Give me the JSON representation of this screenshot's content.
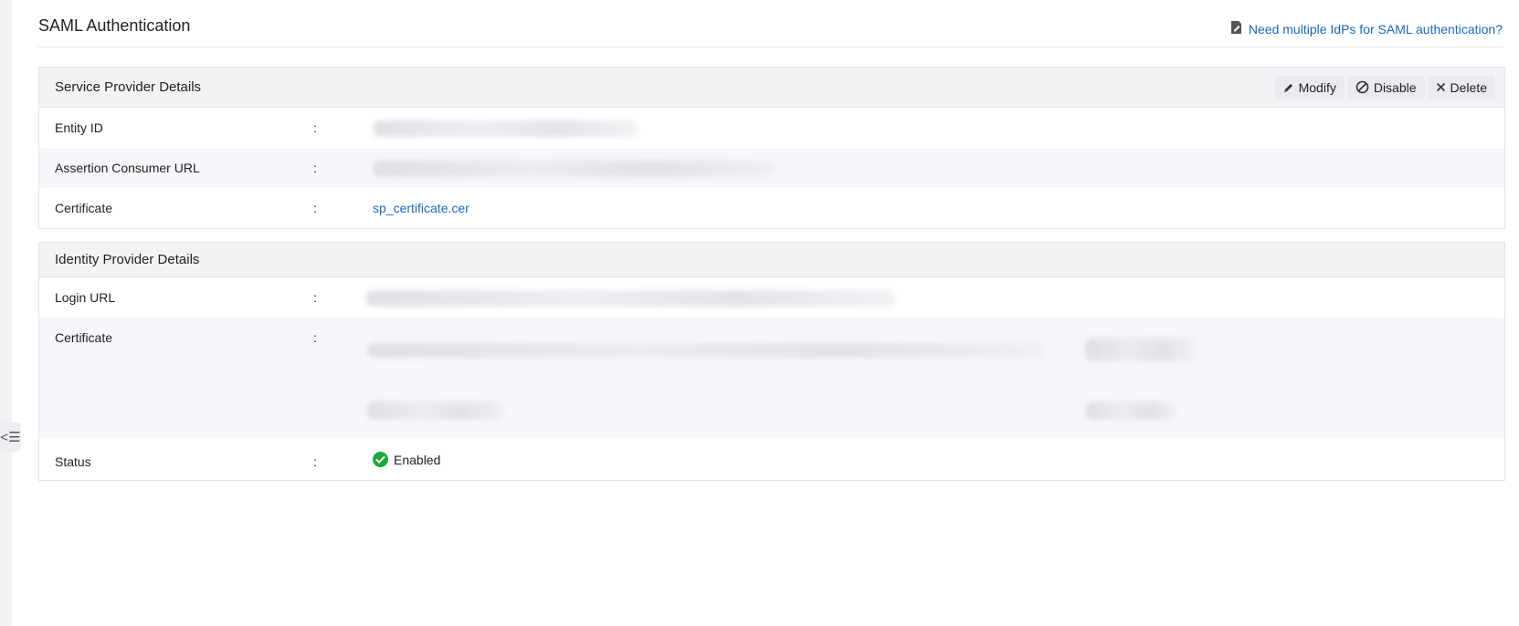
{
  "page": {
    "title": "SAML Authentication",
    "help_link": "Need multiple IdPs for SAML authentication?"
  },
  "service_provider": {
    "heading": "Service Provider Details",
    "actions": {
      "modify": "Modify",
      "disable": "Disable",
      "delete": "Delete"
    },
    "rows": [
      {
        "label": "Entity ID",
        "colon": ":"
      },
      {
        "label": "Assertion Consumer URL",
        "colon": ":"
      },
      {
        "label": "Certificate",
        "colon": ":",
        "value": "sp_certificate.cer"
      }
    ]
  },
  "identity_provider": {
    "heading": "Identity Provider Details",
    "rows": [
      {
        "label": "Login URL",
        "colon": ":"
      },
      {
        "label": "Certificate",
        "colon": ":"
      },
      {
        "label": "Status",
        "colon": ":",
        "value": "Enabled"
      }
    ]
  },
  "icons": {
    "help": "document-edit-icon",
    "modify": "pencil-icon",
    "disable": "ban-icon",
    "delete": "close-icon",
    "status": "check-circle-icon",
    "collapse": "collapse-menu-icon"
  },
  "colors": {
    "link": "#1a67c0",
    "enabled": "#1fa93a",
    "header_bg": "#f2f3f5"
  }
}
